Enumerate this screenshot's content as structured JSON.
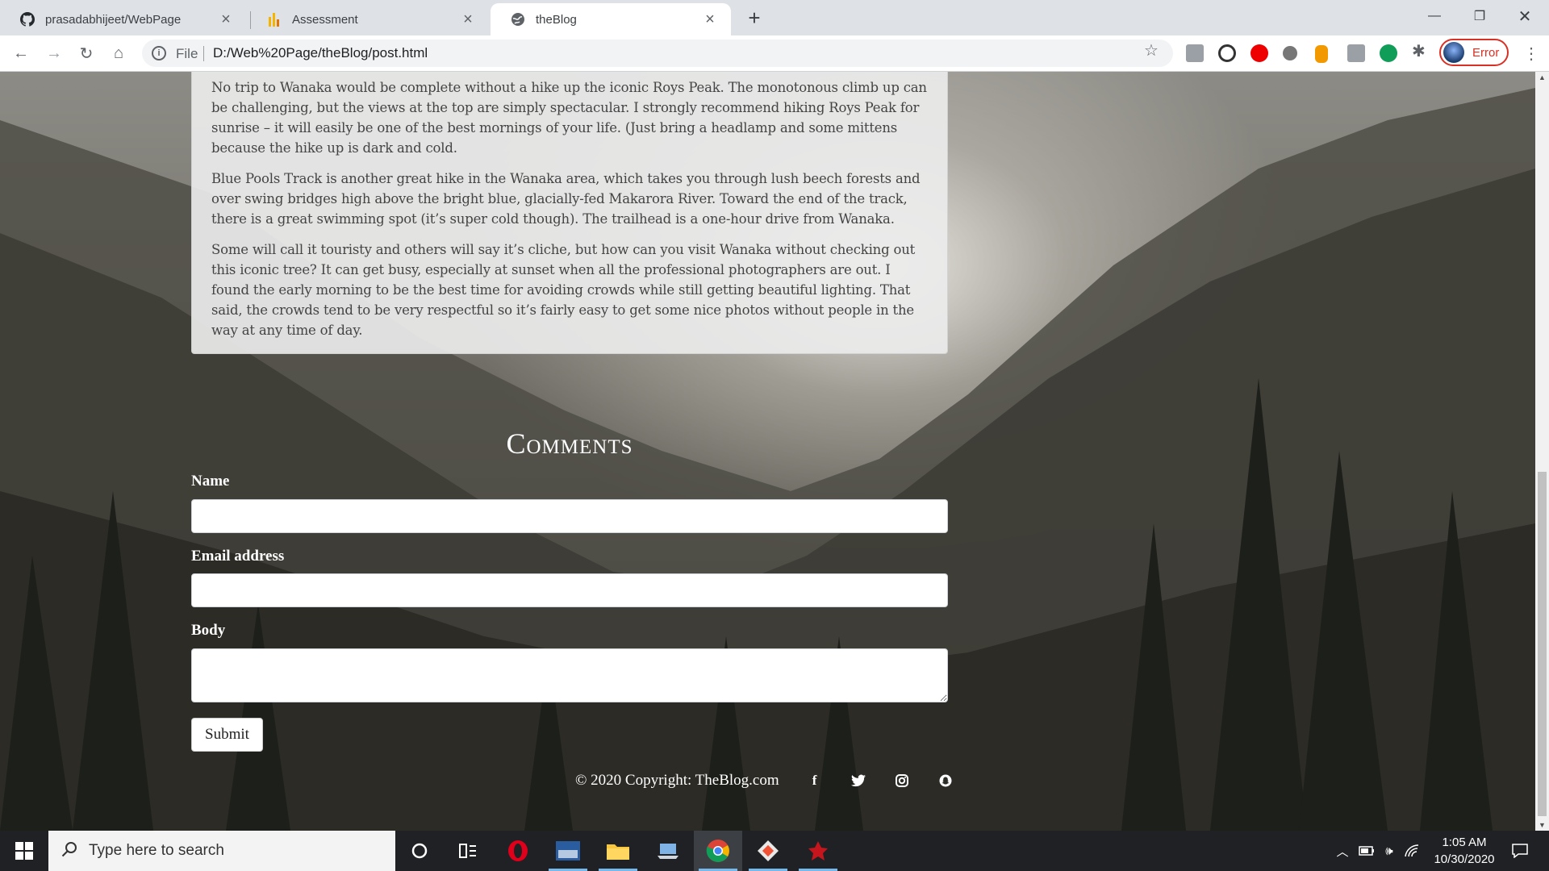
{
  "browser": {
    "tabs": [
      {
        "title": "prasadabhijeet/WebPage",
        "icon": "github-icon"
      },
      {
        "title": "Assessment",
        "icon": "bars-icon"
      },
      {
        "title": "theBlog",
        "icon": "globe-icon",
        "active": true
      }
    ],
    "address": {
      "scheme_label": "File",
      "url": "D:/Web%20Page/theBlog/post.html"
    },
    "profile_status": "Error"
  },
  "article": {
    "paragraphs": [
      "No trip to Wanaka would be complete without a hike up the iconic Roys Peak. The monotonous climb up can be challenging, but the views at the top are simply spectacular. I strongly recommend hiking Roys Peak for sunrise – it will easily be one of the best mornings of your life. (Just bring a headlamp and some mittens because the hike up is dark and cold.",
      "Blue Pools Track is another great hike in the Wanaka area, which takes you through lush beech forests and over swing bridges high above the bright blue, glacially-fed Makarora River. Toward the end of the track, there is a great swimming spot (it’s super cold though). The trailhead is a one-hour drive from Wanaka.",
      "Some will call it touristy and others will say it’s cliche, but how can you visit Wanaka without checking out this iconic tree? It can get busy, especially at sunset when all the professional photographers are out. I found the early morning to be the best time for avoiding crowds while still getting beautiful lighting. That said, the crowds tend to be very respectful so it’s fairly easy to get some nice photos without people in the way at any time of day."
    ]
  },
  "comments": {
    "title": "Comments",
    "name_label": "Name",
    "name_value": "",
    "email_label": "Email address",
    "email_value": "",
    "body_label": "Body",
    "body_value": "",
    "submit_label": "Submit"
  },
  "footer": {
    "copyright": "© 2020 Copyright: TheBlog.com",
    "social": [
      "facebook-icon",
      "twitter-icon",
      "instagram-icon",
      "snapchat-icon"
    ]
  },
  "taskbar": {
    "search_placeholder": "Type here to search",
    "time": "1:05 AM",
    "date": "10/30/2020"
  }
}
